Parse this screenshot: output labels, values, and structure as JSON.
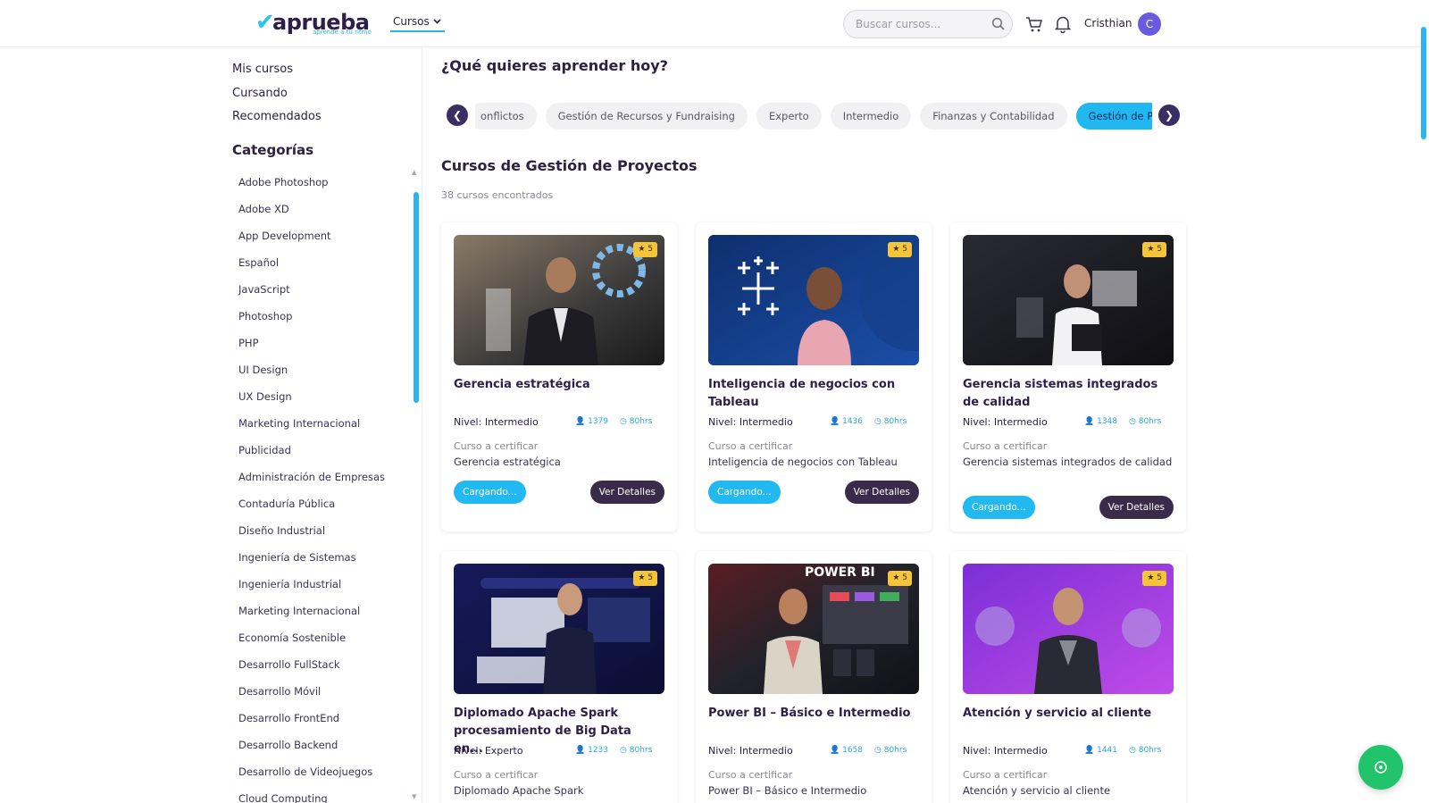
{
  "header": {
    "logo_text": "aprueba",
    "logo_tagline": "aprende a tu ritmo",
    "nav_cursos": "Cursos",
    "search_placeholder": "Buscar cursos...",
    "user_name": "Cristhian",
    "avatar_initial": "C"
  },
  "sidebar": {
    "links": [
      "Mis cursos",
      "Cursando",
      "Recomendados"
    ],
    "categories_heading": "Categorías",
    "categories": [
      "Adobe Photoshop",
      "Adobe XD",
      "App Development",
      "Español",
      "JavaScript",
      "Photoshop",
      "PHP",
      "UI Design",
      "UX Design",
      "Marketing Internacional",
      "Publicidad",
      "Administración de Empresas",
      "Contaduría Pública",
      "Diseño Industrial",
      "Ingeniería de Sistemas",
      "Ingeniería Industrial",
      "Marketing Internacional",
      "Economía Sostenible",
      "Desarrollo FullStack",
      "Desarrollo Móvil",
      "Desarrollo FrontEnd",
      "Desarrollo Backend",
      "Desarrollo de Videojuegos",
      "Cloud Computing"
    ]
  },
  "main": {
    "question": "¿Qué quieres aprender hoy?",
    "chips": [
      "onflictos",
      "Gestión de Recursos y Fundraising",
      "Experto",
      "Intermedio",
      "Finanzas y Contabilidad",
      "Gestión de Proyectos"
    ],
    "active_chip_index": 5,
    "section_title": "Cursos de Gestión de Proyectos",
    "found_text": "38 cursos encontrados",
    "cert_label": "Curso a certificar",
    "loading_label": "Cargando...",
    "details_label": "Ver Detalles",
    "courses": [
      {
        "title": "Gerencia estratégica",
        "level": "Nivel: Intermedio",
        "students": "1379",
        "hours": "80hrs",
        "rating": "5",
        "cert": "Gerencia estratégica"
      },
      {
        "title": "Inteligencia de negocios con Tableau",
        "level": "Nivel: Intermedio",
        "students": "1436",
        "hours": "80hrs",
        "rating": "5",
        "cert": "Inteligencia de negocios con Tableau"
      },
      {
        "title": "Gerencia sistemas integrados de calidad",
        "level": "Nivel: Intermedio",
        "students": "1348",
        "hours": "80hrs",
        "rating": "5",
        "cert": "Gerencia sistemas integrados de calidad"
      },
      {
        "title": "Diplomado Apache Spark procesamiento de Big Data en...",
        "level": "Nivel: Experto",
        "students": "1233",
        "hours": "80hrs",
        "rating": "5",
        "cert": "Diplomado Apache Spark"
      },
      {
        "title": "Power BI – Básico e Intermedio",
        "level": "Nivel: Intermedio",
        "students": "1658",
        "hours": "80hrs",
        "rating": "5",
        "cert": "Power BI – Básico e Intermedio",
        "thumb_text": "POWER BI"
      },
      {
        "title": "Atención y servicio al cliente",
        "level": "Nivel: Intermedio",
        "students": "1441",
        "hours": "80hrs",
        "rating": "5",
        "cert": "Atención y servicio al cliente"
      }
    ]
  },
  "colors": {
    "brand_dark": "#2d1e4a",
    "accent_blue": "#21b8f2",
    "details_button": "#3b2b4a",
    "rating_badge": "#f4c53a",
    "fab_green": "#21c46b"
  },
  "icons": [
    "logo-check-icon",
    "chevron-down-icon",
    "search-icon",
    "cart-icon",
    "bell-icon",
    "chevron-left-icon",
    "chevron-right-icon",
    "star-icon",
    "user-icon",
    "clock-icon",
    "whatsapp-icon"
  ]
}
